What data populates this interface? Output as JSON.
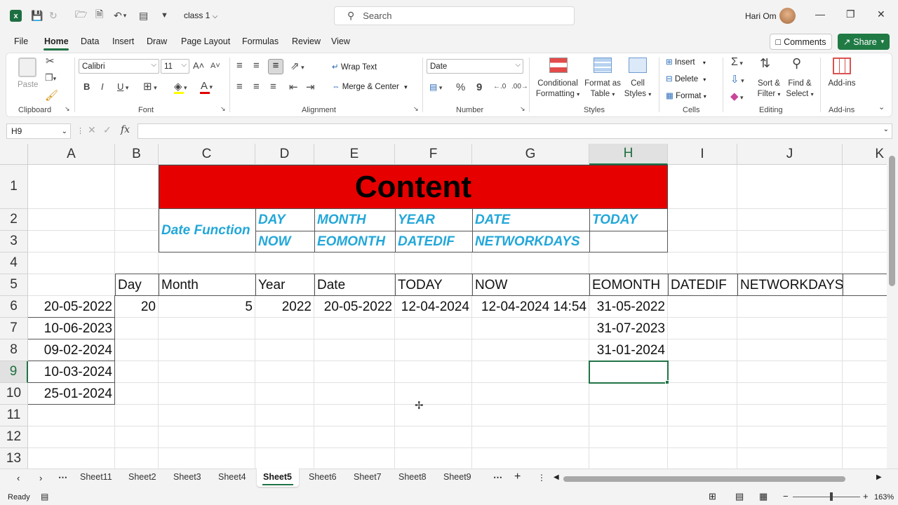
{
  "app": {
    "filename": "class 1",
    "search_placeholder": "Search",
    "user": "Hari Om"
  },
  "menu": [
    "File",
    "Home",
    "Data",
    "Insert",
    "Draw",
    "Page Layout",
    "Formulas",
    "Review",
    "View"
  ],
  "topright": {
    "comments": "Comments",
    "share": "Share"
  },
  "ribbon": {
    "clipboard": {
      "paste": "Paste",
      "label": "Clipboard"
    },
    "font": {
      "name": "Calibri",
      "size": "11",
      "label": "Font",
      "bold": "B",
      "italic": "I",
      "underline": "U"
    },
    "alignment": {
      "wrap": "Wrap Text",
      "merge": "Merge & Center",
      "label": "Alignment"
    },
    "number": {
      "format": "Date",
      "label": "Number",
      "percent": "%",
      "comma": "9"
    },
    "styles": {
      "conditional": [
        "Conditional",
        "Formatting"
      ],
      "format_table": [
        "Format as",
        "Table"
      ],
      "cell_styles": [
        "Cell",
        "Styles"
      ],
      "label": "Styles"
    },
    "cells": {
      "insert": "Insert",
      "delete": "Delete",
      "format": "Format",
      "label": "Cells"
    },
    "editing": {
      "sort": [
        "Sort &",
        "Filter"
      ],
      "find": [
        "Find &",
        "Select"
      ],
      "label": "Editing"
    },
    "addins": {
      "btn": "Add-ins",
      "label": "Add-ins"
    }
  },
  "formula_bar": {
    "namebox": "H9",
    "fx": "fx",
    "value": ""
  },
  "columns": [
    "A",
    "B",
    "C",
    "D",
    "E",
    "F",
    "G",
    "H",
    "I",
    "J",
    "K"
  ],
  "rows": [
    "1",
    "2",
    "3",
    "4",
    "5",
    "6",
    "7",
    "8",
    "9",
    "10",
    "11",
    "12",
    "13"
  ],
  "sheet": {
    "banner": "Content",
    "date_function": "Date Function",
    "functions_row2": [
      "DAY",
      "MONTH",
      "YEAR",
      "DATE",
      "TODAY"
    ],
    "functions_row3": [
      "NOW",
      "EOMONTH",
      "DATEDIF",
      "NETWORKDAYS"
    ],
    "headers": [
      "Day",
      "Month",
      "Year",
      "Date",
      "TODAY",
      "NOW",
      "EOMONTH",
      "DATEDIF",
      "NETWORKDAYS"
    ],
    "dates": [
      "20-05-2022",
      "10-06-2023",
      "09-02-2024",
      "10-03-2024",
      "25-01-2024"
    ],
    "row6": {
      "day": "20",
      "month": "5",
      "year": "2022",
      "date": "20-05-2022",
      "today": "12-04-2024",
      "now": "12-04-2024 14:54"
    },
    "eomonth": [
      "31-05-2022",
      "31-07-2023",
      "31-01-2024"
    ]
  },
  "sheet_tabs": [
    "Sheet11",
    "Sheet2",
    "Sheet3",
    "Sheet4",
    "Sheet5",
    "Sheet6",
    "Sheet7",
    "Sheet8",
    "Sheet9"
  ],
  "active_sheet": "Sheet5",
  "status": {
    "ready": "Ready",
    "zoom": "163%"
  }
}
